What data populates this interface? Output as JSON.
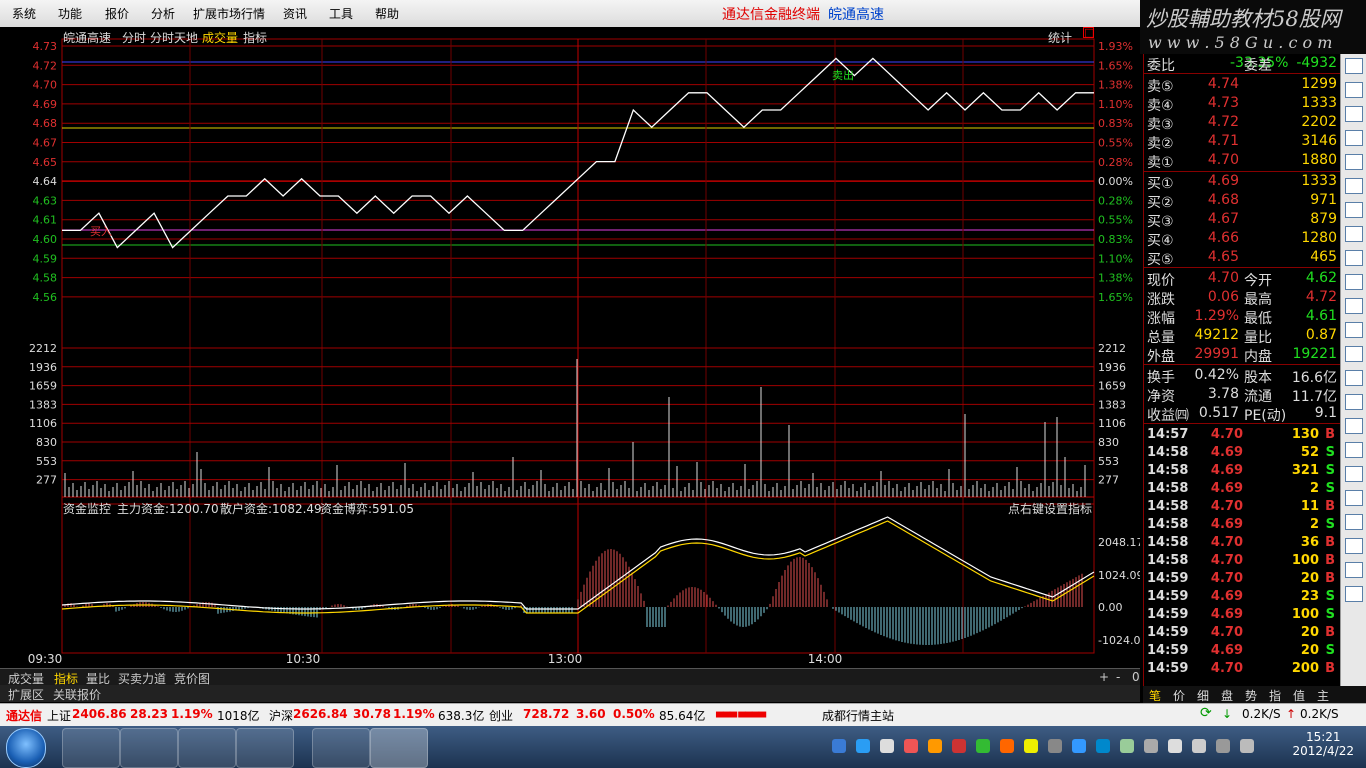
{
  "menu": [
    "系统",
    "功能",
    "报价",
    "分析",
    "扩展市场行情",
    "资讯",
    "工具",
    "帮助"
  ],
  "window_title": {
    "left": "通达信金融终端",
    "right": "皖通高速"
  },
  "logo": {
    "line1": "炒股輔助教材58股网",
    "line2": "w w w . 5 8 G u . c o m"
  },
  "chart_header": {
    "stock": "皖通高速",
    "items": [
      "分时",
      "分时天地",
      "成交量",
      "指标"
    ],
    "stats_label": "统计"
  },
  "price_axis": {
    "left": [
      "4.73",
      "4.72",
      "4.70",
      "4.69",
      "4.68",
      "4.67",
      "4.65",
      "4.64",
      "4.63",
      "4.61",
      "4.60",
      "4.59",
      "4.58",
      "4.56"
    ],
    "right": [
      "1.93%",
      "1.65%",
      "1.38%",
      "1.10%",
      "0.83%",
      "0.55%",
      "0.28%",
      "0.00%",
      "0.28%",
      "0.55%",
      "0.83%",
      "1.10%",
      "1.38%",
      "1.65%"
    ]
  },
  "volume_axis": [
    "2212",
    "1936",
    "1659",
    "1383",
    "1106",
    "830",
    "553",
    "277"
  ],
  "fund_panel": {
    "label": "资金监控",
    "main": "主力资金:1200.70",
    "retail": "散户资金:1082.49",
    "game": "资金博弈:591.05",
    "hint": "点右键设置指标",
    "axis": [
      "2048.17",
      "1024.09",
      "0.00",
      "-1024.09"
    ]
  },
  "time_axis": [
    "09:30",
    "10:30",
    "13:00",
    "14:00"
  ],
  "chart_data": {
    "type": "line",
    "title": "皖通高速",
    "prev_close": 4.64,
    "price_series": [
      4.62,
      4.62,
      4.63,
      4.61,
      4.62,
      4.63,
      4.61,
      4.62,
      4.63,
      4.64,
      4.64,
      4.65,
      4.64,
      4.65,
      4.64,
      4.64,
      4.63,
      4.64,
      4.63,
      4.64,
      4.64,
      4.63,
      4.64,
      4.63,
      4.62,
      4.62,
      4.63,
      4.64,
      4.65,
      4.66,
      4.66,
      4.69,
      4.68,
      4.69,
      4.7,
      4.7,
      4.69,
      4.68,
      4.69,
      4.69,
      4.7,
      4.71,
      4.72,
      4.71,
      4.72,
      4.71,
      4.7,
      4.69,
      4.7,
      4.69,
      4.7,
      4.69,
      4.69,
      4.7,
      4.69,
      4.7,
      4.7
    ],
    "markers": [
      {
        "label": "买入",
        "price": 4.62
      },
      {
        "label": "卖出",
        "price": 4.72
      }
    ]
  },
  "panel": {
    "weibi": {
      "label": "委比",
      "value": "-33.35%",
      "label2": "委差",
      "value2": "-4932"
    },
    "sell": [
      {
        "label": "卖⑤",
        "price": "4.74",
        "vol": "1299"
      },
      {
        "label": "卖④",
        "price": "4.73",
        "vol": "1333"
      },
      {
        "label": "卖③",
        "price": "4.72",
        "vol": "2202"
      },
      {
        "label": "卖②",
        "price": "4.71",
        "vol": "3146"
      },
      {
        "label": "卖①",
        "price": "4.70",
        "vol": "1880"
      }
    ],
    "buy": [
      {
        "label": "买①",
        "price": "4.69",
        "vol": "1333"
      },
      {
        "label": "买②",
        "price": "4.68",
        "vol": "971"
      },
      {
        "label": "买③",
        "price": "4.67",
        "vol": "879"
      },
      {
        "label": "买④",
        "price": "4.66",
        "vol": "1280"
      },
      {
        "label": "买⑤",
        "price": "4.65",
        "vol": "465"
      }
    ],
    "quote": [
      {
        "l1": "现价",
        "v1": "4.70",
        "l2": "今开",
        "v2": "4.62"
      },
      {
        "l1": "涨跌",
        "v1": "0.06",
        "l2": "最高",
        "v2": "4.72"
      },
      {
        "l1": "涨幅",
        "v1": "1.29%",
        "l2": "最低",
        "v2": "4.61"
      },
      {
        "l1": "总量",
        "v1": "49212",
        "l2": "量比",
        "v2": "0.87"
      },
      {
        "l1": "外盘",
        "v1": "29991",
        "l2": "内盘",
        "v2": "19221"
      }
    ],
    "fin": [
      {
        "l1": "换手",
        "v1": "0.42%",
        "l2": "股本",
        "v2": "16.6亿"
      },
      {
        "l1": "净资",
        "v1": "3.78",
        "l2": "流通",
        "v2": "11.7亿"
      },
      {
        "l1": "收益㈣",
        "v1": "0.517",
        "l2": "PE(动)",
        "v2": "9.1"
      }
    ],
    "ticks": [
      {
        "t": "14:57",
        "p": "4.70",
        "v": "130",
        "s": "B"
      },
      {
        "t": "14:58",
        "p": "4.69",
        "v": "52",
        "s": "S"
      },
      {
        "t": "14:58",
        "p": "4.69",
        "v": "321",
        "s": "S"
      },
      {
        "t": "14:58",
        "p": "4.69",
        "v": "2",
        "s": "S"
      },
      {
        "t": "14:58",
        "p": "4.70",
        "v": "11",
        "s": "B"
      },
      {
        "t": "14:58",
        "p": "4.69",
        "v": "2",
        "s": "S"
      },
      {
        "t": "14:58",
        "p": "4.70",
        "v": "36",
        "s": "B"
      },
      {
        "t": "14:58",
        "p": "4.70",
        "v": "100",
        "s": "B"
      },
      {
        "t": "14:59",
        "p": "4.70",
        "v": "20",
        "s": "B"
      },
      {
        "t": "14:59",
        "p": "4.69",
        "v": "23",
        "s": "S"
      },
      {
        "t": "14:59",
        "p": "4.69",
        "v": "100",
        "s": "S"
      },
      {
        "t": "14:59",
        "p": "4.70",
        "v": "20",
        "s": "B"
      },
      {
        "t": "14:59",
        "p": "4.69",
        "v": "20",
        "s": "S"
      },
      {
        "t": "14:59",
        "p": "4.70",
        "v": "200",
        "s": "B"
      }
    ]
  },
  "right_tabs": [
    "笔",
    "价",
    "细",
    "盘",
    "势",
    "指",
    "值",
    "主"
  ],
  "tabs": [
    "成交量",
    "指标",
    "量比",
    "买卖力道",
    "竞价图"
  ],
  "tabs2": [
    "扩展区",
    "关联报价"
  ],
  "tab_controls": [
    "+",
    "-",
    "0"
  ],
  "status": {
    "brand": "通达信",
    "sh_label": "上证",
    "sh": "2406.86",
    "sh_chg": "28.23",
    "sh_pct": "1.19%",
    "sh_amt": "1018亿",
    "sz_label": "沪深",
    "sz": "2626.84",
    "sz_chg": "30.78",
    "sz_pct": "1.19%",
    "sz_amt": "638.3亿",
    "cy_label": "创业",
    "cy": "728.72",
    "cy_chg": "3.60",
    "cy_pct": "0.50%",
    "cy_amt": "85.64亿",
    "site": "成都行情主站",
    "down": "0.2K/S",
    "up": "0.2K/S"
  },
  "clock": {
    "time": "15:21",
    "date": "2012/4/22"
  }
}
